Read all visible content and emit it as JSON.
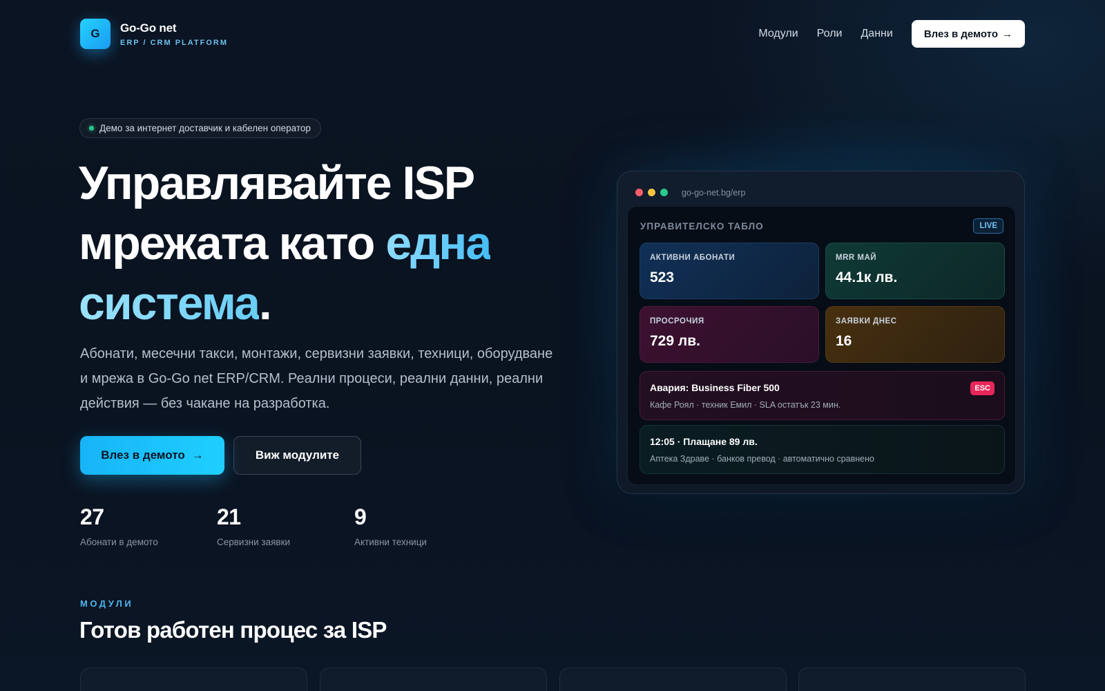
{
  "brand": {
    "logo_letter": "G",
    "name": "Go-Go net",
    "subtitle": "ERP / CRM PLATFORM"
  },
  "nav": {
    "links": [
      "Модули",
      "Роли",
      "Данни"
    ],
    "cta_label": "Влез в демото",
    "cta_arrow": "→"
  },
  "hero": {
    "pill": "Демо за интернет доставчик и кабелен оператор",
    "title_line1": "Управлявайте ISP",
    "title_line2_plain": "мрежата като ",
    "title_line2_accent": "една",
    "title_line3_accent": "система",
    "title_period": ".",
    "description": "Абонати, месечни такси, монтажи, сервизни заявки, техници, оборудване и мрежа в Go-Go net ERP/CRM. Реални процеси, реални данни, реални действия — без чакане на разработка.",
    "primary_button": "Влез в демото",
    "primary_arrow": "→",
    "secondary_button": "Виж модулите"
  },
  "stats": [
    {
      "value": "27",
      "label": "Абонати в демото"
    },
    {
      "value": "21",
      "label": "Сервизни заявки"
    },
    {
      "value": "9",
      "label": "Активни техници"
    }
  ],
  "modules": {
    "eyebrow": "МОДУЛИ",
    "title": "Готов работен процес за ISP"
  },
  "window": {
    "url": "go-go-net.bg/erp",
    "dots_colors": [
      "#ff5f6d",
      "#f5c542",
      "#28c98b"
    ],
    "panel_title": "УПРАВИТЕЛСКО ТАБЛО",
    "live_badge": "LIVE",
    "kpis": [
      {
        "label": "АКТИВНИ АБОНАТИ",
        "value": "523"
      },
      {
        "label": "MRR МАЙ",
        "value": "44.1к лв."
      },
      {
        "label": "ПРОСРОЧИЯ",
        "value": "729 лв."
      },
      {
        "label": "ЗАЯВКИ ДНЕС",
        "value": "16"
      }
    ],
    "events": [
      {
        "title": "Авария: Business Fiber 500",
        "subtitle": "Кафе Роял · техник Емил · SLA остатък 23 мин.",
        "badge": "ESC"
      },
      {
        "title": "12:05 · Плащане 89 лв.",
        "subtitle": "Аптека Здраве · банков превод · автоматично сравнено"
      }
    ]
  },
  "colors": {
    "accent": "#1fc3ff",
    "background": "#0a1320",
    "esc_badge": "#e8275a"
  }
}
